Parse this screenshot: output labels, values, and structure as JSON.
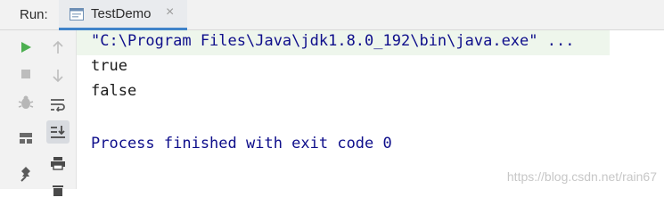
{
  "header": {
    "run_label": "Run:",
    "tab": {
      "label": "TestDemo",
      "close": "×"
    }
  },
  "toolbar_left": [
    "run-icon",
    "stop-icon",
    "debug-icon",
    "layout-icon",
    "pin-icon"
  ],
  "toolbar_right": [
    "up-arrow-icon",
    "down-arrow-icon",
    "soft-wrap-icon",
    "scroll-to-end-icon",
    "print-icon",
    "trash-icon"
  ],
  "console": {
    "command": "\"C:\\Program Files\\Java\\jdk1.8.0_192\\bin\\java.exe\" ...",
    "output": [
      "true",
      "false"
    ],
    "exit_message": "Process finished with exit code 0"
  },
  "watermark": "https://blog.csdn.net/rain67",
  "colors": {
    "run_green": "#4caf50",
    "console_blue": "#0e0e8b",
    "command_bg": "#eef6ec",
    "tab_underline": "#4083c9"
  }
}
